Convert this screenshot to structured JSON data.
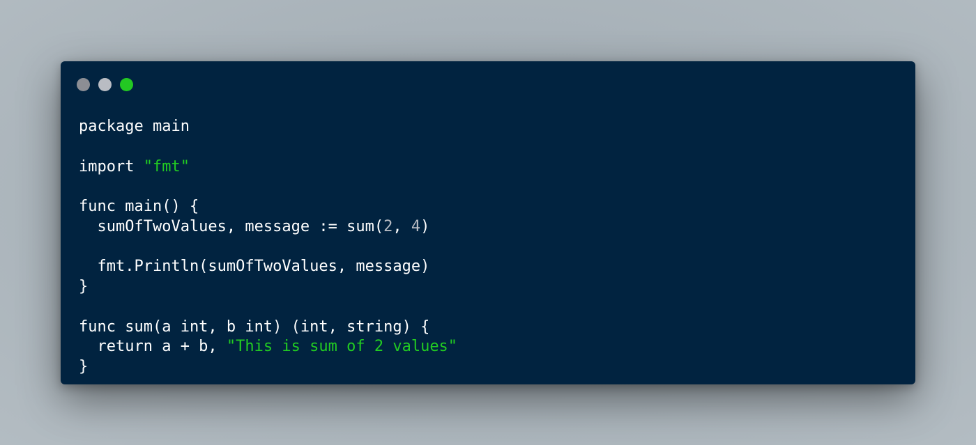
{
  "window": {
    "title_buttons": [
      {
        "name": "close",
        "color": "#8c8e94"
      },
      {
        "name": "minimize",
        "color": "#b9bcc3"
      },
      {
        "name": "zoom",
        "color": "#23c823"
      }
    ]
  },
  "colors": {
    "background": "#012340",
    "text": "#ffffff",
    "string": "#22cc22",
    "number": "#b9bcc3"
  },
  "code": {
    "language": "go",
    "lines": [
      [
        {
          "t": "plain",
          "v": "package main"
        }
      ],
      [],
      [
        {
          "t": "plain",
          "v": "import "
        },
        {
          "t": "str",
          "v": "\"fmt\""
        }
      ],
      [],
      [
        {
          "t": "plain",
          "v": "func main() {"
        }
      ],
      [
        {
          "t": "plain",
          "v": "  sumOfTwoValues, message := sum("
        },
        {
          "t": "num",
          "v": "2"
        },
        {
          "t": "plain",
          "v": ", "
        },
        {
          "t": "num",
          "v": "4"
        },
        {
          "t": "plain",
          "v": ")"
        }
      ],
      [],
      [
        {
          "t": "plain",
          "v": "  fmt.Println(sumOfTwoValues, message)"
        }
      ],
      [
        {
          "t": "plain",
          "v": "}"
        }
      ],
      [],
      [
        {
          "t": "plain",
          "v": "func sum(a int, b int) (int, string) {"
        }
      ],
      [
        {
          "t": "plain",
          "v": "  return a + b, "
        },
        {
          "t": "str",
          "v": "\"This is sum of 2 values\""
        }
      ],
      [
        {
          "t": "plain",
          "v": "}"
        }
      ]
    ]
  }
}
